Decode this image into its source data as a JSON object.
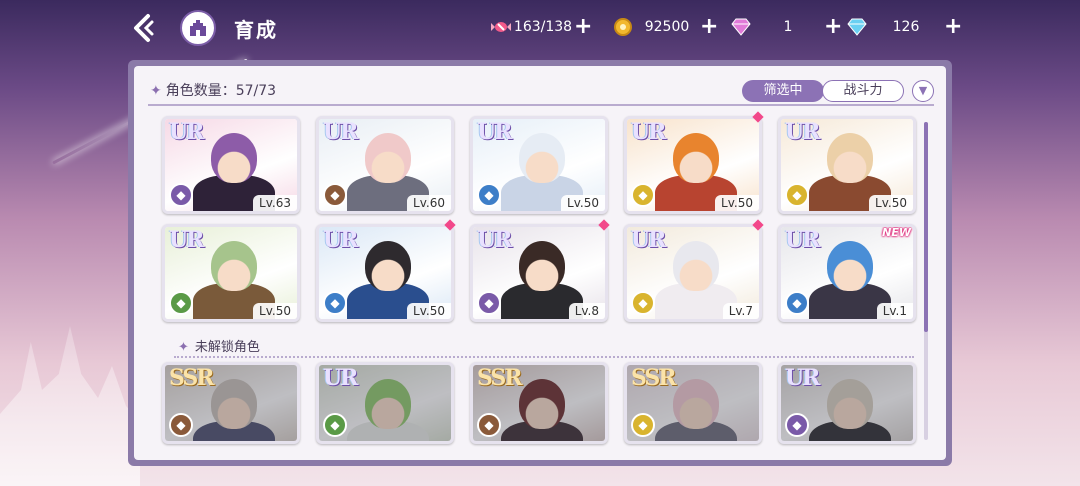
{
  "header": {
    "title": "育成",
    "back_icon": "back-arrow-icon",
    "home_icon": "castle-home-icon"
  },
  "resources": [
    {
      "name": "candy",
      "icon": "candy-icon",
      "value": "163/138"
    },
    {
      "name": "gold",
      "icon": "gold-coin-icon",
      "value": "92500"
    },
    {
      "name": "pink-gem",
      "icon": "pink-diamond-icon",
      "value": "1"
    },
    {
      "name": "blue-gem",
      "icon": "blue-diamond-icon",
      "value": "126"
    }
  ],
  "panel": {
    "count_label": "角色数量：57/73",
    "filter_label": "筛选中",
    "power_label": "战斗力",
    "unlocked_section": "未解锁角色"
  },
  "owned": [
    {
      "rarity": "UR",
      "level": "Lv.63",
      "elem_color": "#7a5aa8",
      "bg": "#f6d9e6",
      "hair": "#8d5ca8",
      "outfit": "#2e2238",
      "dot": false,
      "new": false
    },
    {
      "rarity": "UR",
      "level": "Lv.60",
      "elem_color": "#8a5a3a",
      "bg": "#e8eef4",
      "hair": "#f0c9c9",
      "outfit": "#6d6e7e",
      "dot": false,
      "new": false
    },
    {
      "rarity": "UR",
      "level": "Lv.50",
      "elem_color": "#3d7ec8",
      "bg": "#e6eff8",
      "hair": "#e6ecf4",
      "outfit": "#c9d4e6",
      "dot": false,
      "new": false
    },
    {
      "rarity": "UR",
      "level": "Lv.50",
      "elem_color": "#d9b42e",
      "bg": "#f8e3cc",
      "hair": "#e8842e",
      "outfit": "#b84430",
      "dot": true,
      "new": false
    },
    {
      "rarity": "UR",
      "level": "Lv.50",
      "elem_color": "#d9b42e",
      "bg": "#f6e9d8",
      "hair": "#ecd0a8",
      "outfit": "#8a4a30",
      "dot": false,
      "new": false
    },
    {
      "rarity": "UR",
      "level": "Lv.50",
      "elem_color": "#5a9a46",
      "bg": "#e8f0d8",
      "hair": "#a6c48c",
      "outfit": "#7a5a3a",
      "dot": false,
      "new": false
    },
    {
      "rarity": "UR",
      "level": "Lv.50",
      "elem_color": "#3d7ec8",
      "bg": "#dbe8f6",
      "hair": "#2e2a2e",
      "outfit": "#2a4e8e",
      "dot": true,
      "new": false
    },
    {
      "rarity": "UR",
      "level": "Lv.8",
      "elem_color": "#7a5aa8",
      "bg": "#e8e3ea",
      "hair": "#3a2a26",
      "outfit": "#2a2a2e",
      "dot": true,
      "new": false
    },
    {
      "rarity": "UR",
      "level": "Lv.7",
      "elem_color": "#d9b42e",
      "bg": "#f2eadc",
      "hair": "#e8e8ee",
      "outfit": "#f0ecf0",
      "dot": true,
      "new": false
    },
    {
      "rarity": "UR",
      "level": "Lv.1",
      "elem_color": "#3d7ec8",
      "bg": "#e6e6ea",
      "hair": "#4a8ed6",
      "outfit": "#3a3646",
      "dot": false,
      "new": true
    }
  ],
  "locked": [
    {
      "rarity": "SSR",
      "elem_color": "#8a5a3a",
      "bg": "#d8d0c8",
      "hair": "#c8c0b8",
      "outfit": "#4a4e6e"
    },
    {
      "rarity": "UR",
      "elem_color": "#5a9a46",
      "bg": "#d8e0d0",
      "hair": "#8ec86a",
      "outfit": "#e8ece6"
    },
    {
      "rarity": "SSR",
      "elem_color": "#8a5a3a",
      "bg": "#d8c8c4",
      "hair": "#6a2a2a",
      "outfit": "#3a2a30"
    },
    {
      "rarity": "SSR",
      "elem_color": "#d9b42e",
      "bg": "#e8dce0",
      "hair": "#f0c8d0",
      "outfit": "#6a6a7a"
    },
    {
      "rarity": "UR",
      "elem_color": "#7a5aa8",
      "bg": "#d8d4d0",
      "hair": "#d8cfc0",
      "outfit": "#2a2a2e"
    }
  ],
  "new_badge": "NEW"
}
